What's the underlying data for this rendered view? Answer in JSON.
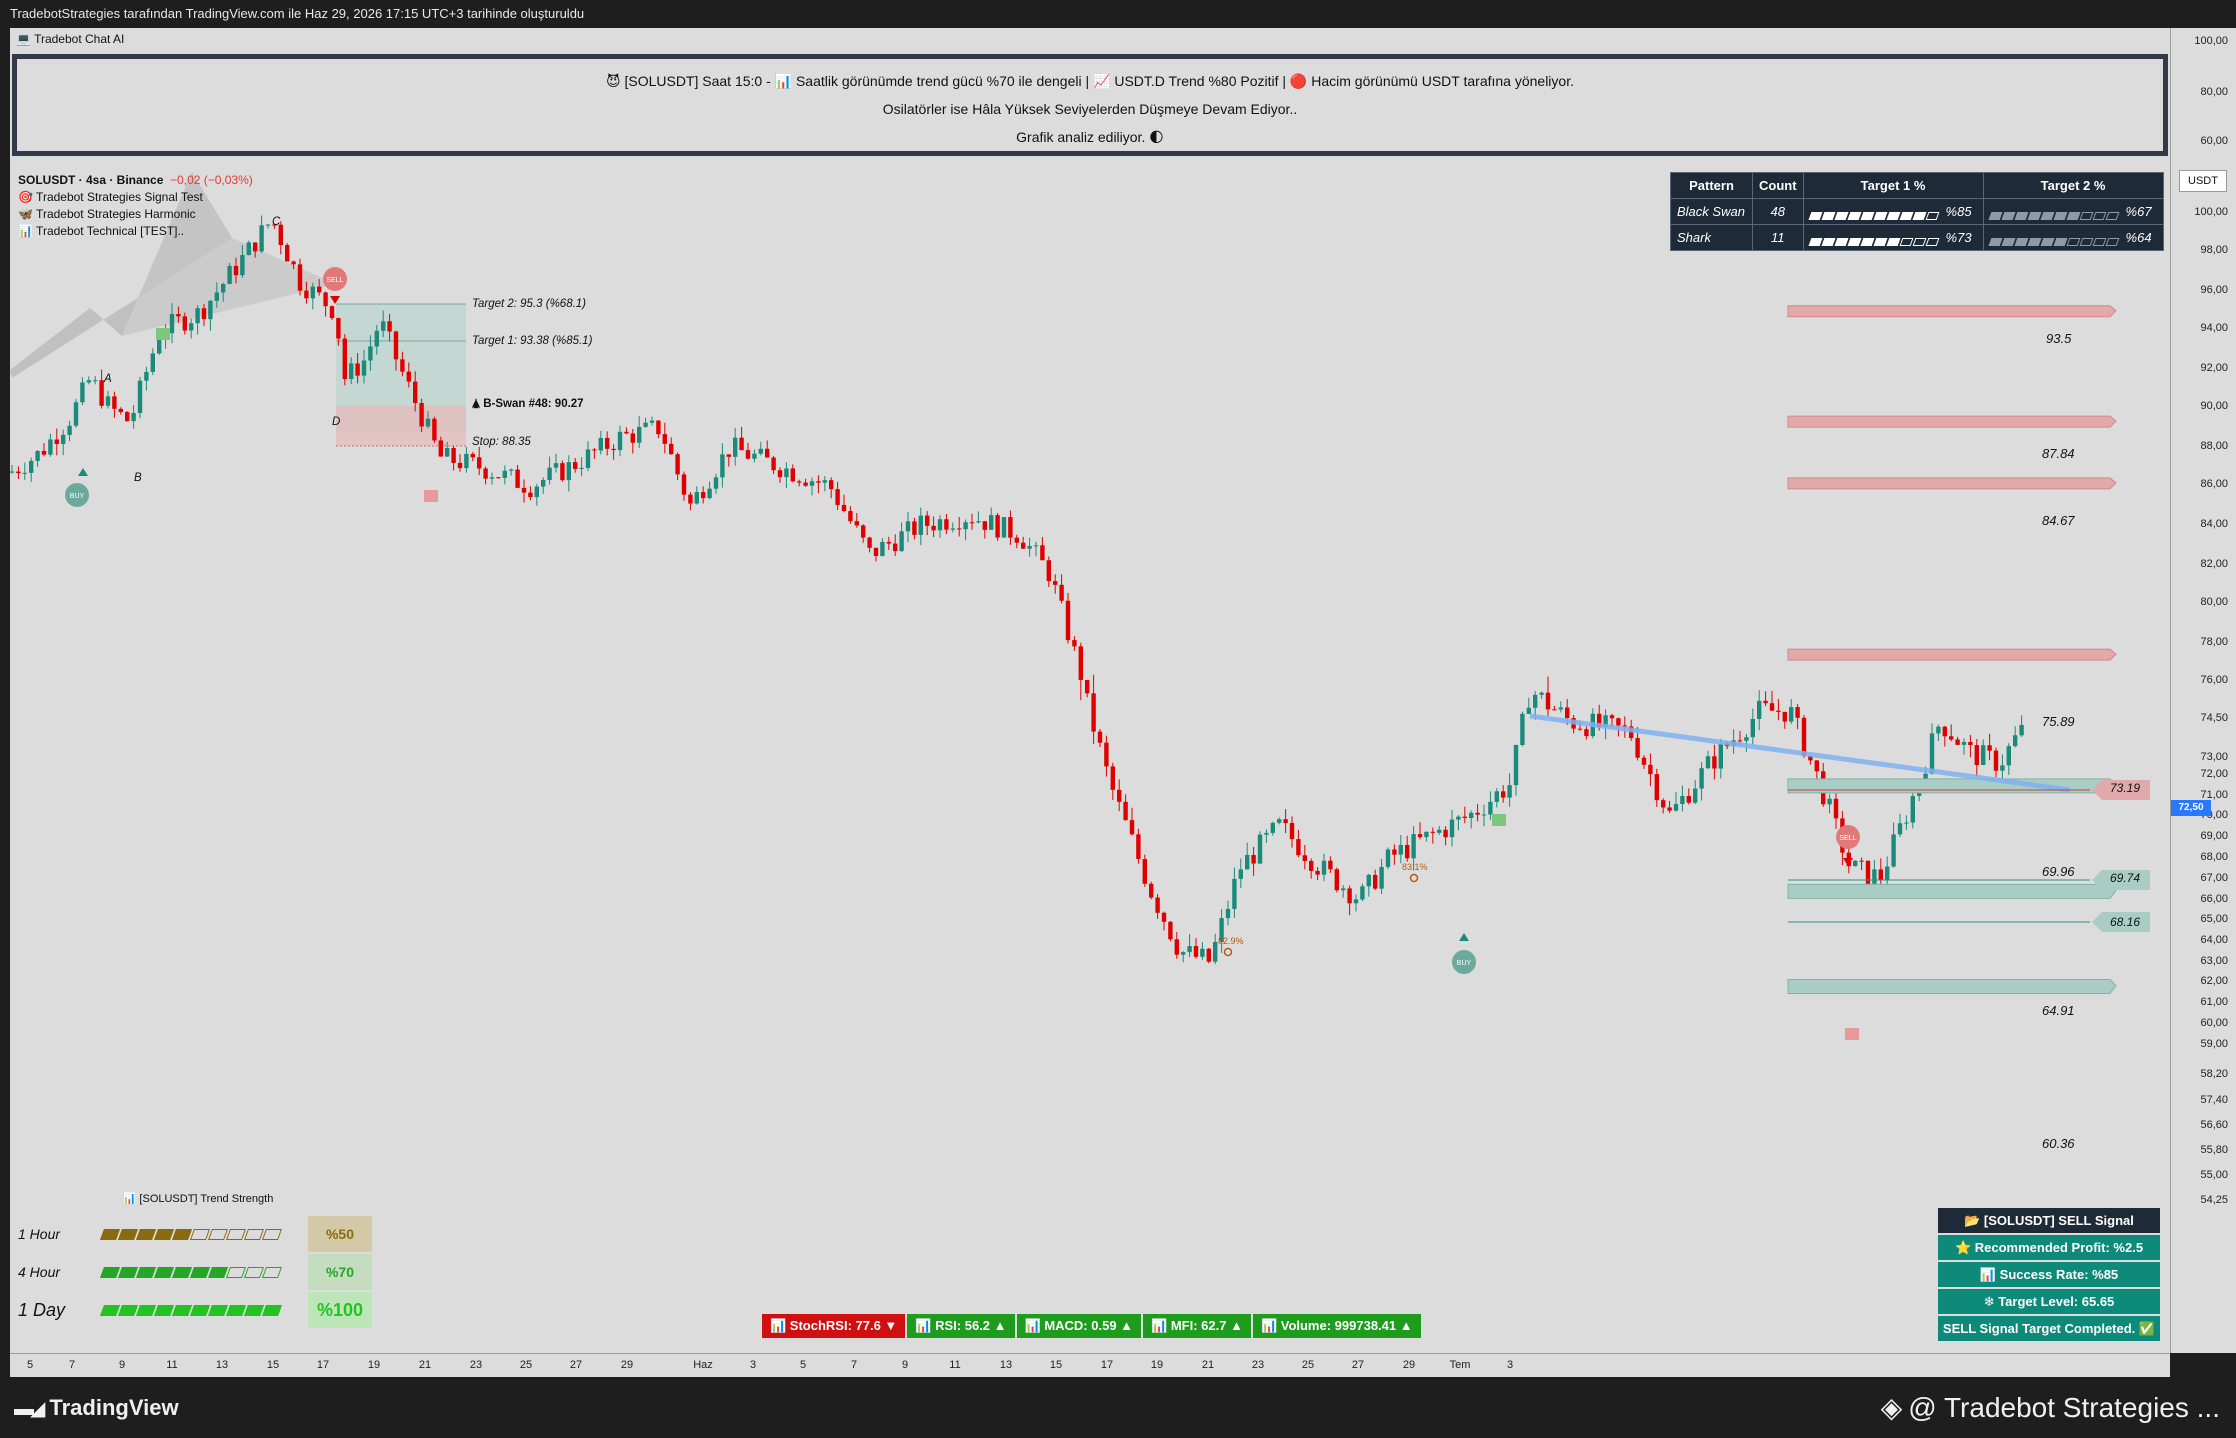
{
  "header": {
    "caption": "TradebotStrategies tarafından TradingView.com ile Haz 29, 2026 17:15 UTC+3 tarihinde oluşturuldu"
  },
  "chat": {
    "title": "Tradebot Chat AI",
    "line1": "😈 [SOLUSDT] Saat 15:0 - 📊 Saatlik görünümde trend gücü %70 ile dengeli | 📈 USDT.D Trend %80 Pozitif | 🔴 Hacim görünümü USDT tarafına yöneliyor.",
    "line2": "Osilatörler ise Hâla Yüksek Seviyelerden Düşmeye Devam Ediyor..",
    "line3": "Grafik analiz ediliyor. 🌓"
  },
  "legend": {
    "symbol": "SOLUSDT · 4sa · Binance",
    "change": "−0,02 (−0,03%)",
    "indicators": [
      "🎯 Tradebot Strategies Signal Test",
      "🦋 Tradebot Strategies Harmonic",
      "📊 Tradebot Technical [TEST].."
    ]
  },
  "pattern_table": {
    "headers": [
      "Pattern",
      "Count",
      "Target 1 %",
      "Target 2 %"
    ],
    "rows": [
      {
        "name": "Black Swan",
        "count": "48",
        "t1": "%85",
        "t1_value": 0.85,
        "t2": "%67",
        "t2_value": 0.67
      },
      {
        "name": "Shark",
        "count": "11",
        "t1": "%73",
        "t1_value": 0.73,
        "t2": "%64",
        "t2_value": 0.64
      }
    ]
  },
  "harmonic": {
    "points": {
      "a": "A",
      "b": "B",
      "c": "C",
      "d": "D"
    },
    "target2": "Target 2: 95.3 (%68.1)",
    "target1": "Target 1: 93.38 (%85.1)",
    "pattern": "🛦 B-Swan #48: 90.27",
    "stop": "Stop: 88.35",
    "sell": "SELL",
    "buy": "BUY"
  },
  "fib_labels": {
    "f1": "82.9%",
    "f2": "83.1%"
  },
  "levels": {
    "resistance": [
      {
        "label": "93.5",
        "value": 93.5
      },
      {
        "label": "87.84",
        "value": 87.84
      },
      {
        "label": "84.67",
        "value": 84.67
      },
      {
        "label": "75.89",
        "value": 75.89
      }
    ],
    "support": [
      {
        "label": "69.96",
        "value": 69.96
      },
      {
        "label": "64.91",
        "value": 64.91
      },
      {
        "label": "60.36",
        "value": 60.36
      }
    ],
    "line_73": "73.19",
    "line_69": "69.74",
    "line_68": "68.16"
  },
  "price_axis": {
    "currency": "USDT",
    "current": "72,50",
    "current_value": 72.5,
    "upper_ticks": [
      "100,00",
      "80,00",
      "60,00"
    ],
    "ticks": [
      "100,00",
      "98,00",
      "96,00",
      "94,00",
      "92,00",
      "90,00",
      "88,00",
      "86,00",
      "84,00",
      "82,00",
      "80,00",
      "78,00",
      "76,00",
      "74,50",
      "73,00",
      "72,00",
      "71,00",
      "70,00",
      "69,00",
      "68,00",
      "67,00",
      "66,00",
      "65,00",
      "64,00",
      "63,00",
      "62,00",
      "61,00",
      "60,00",
      "59,00",
      "58,20",
      "57,40",
      "56,60",
      "55,80",
      "55,00",
      "54,25"
    ]
  },
  "time_axis": {
    "ticks": [
      "5",
      "7",
      "9",
      "11",
      "13",
      "15",
      "17",
      "19",
      "21",
      "23",
      "25",
      "27",
      "29",
      "Haz",
      "3",
      "5",
      "7",
      "9",
      "11",
      "13",
      "15",
      "17",
      "19",
      "21",
      "23",
      "25",
      "27",
      "29",
      "Tem",
      "3"
    ]
  },
  "trend_strength": {
    "title": "📊 [SOLUSDT] Trend Strength",
    "rows": [
      {
        "label": "1 Hour",
        "pct": "%50",
        "value": 0.5,
        "color": "#8a6a10",
        "bg": "#d3c9a6"
      },
      {
        "label": "4 Hour",
        "pct": "%70",
        "value": 0.7,
        "color": "#26a626",
        "bg": "#c4dcc0"
      },
      {
        "label": "1 Day",
        "pct": "%100",
        "value": 1.0,
        "color": "#22c322",
        "bg": "#bde6b8"
      }
    ]
  },
  "indicators": [
    {
      "label": "📊 StochRSI: 77.6 ▼",
      "color": "#d01010"
    },
    {
      "label": "📊 RSI: 56.2 ▲",
      "color": "#1e9c1e"
    },
    {
      "label": "📊 MACD: 0.59 ▲",
      "color": "#1e9c1e"
    },
    {
      "label": "📊 MFI: 62.7 ▲",
      "color": "#1e9c1e"
    },
    {
      "label": "📊 Volume: 999738.41 ▲",
      "color": "#1e9c1e"
    }
  ],
  "signal": {
    "title": "📂 [SOLUSDT] SELL Signal",
    "profit": "⭐ Recommended Profit: %2.5",
    "success": "📊 Success Rate: %85",
    "target": "❄ Target Level: 65.65",
    "completed": "SELL Signal Target Completed. ✅"
  },
  "footer": {
    "brand": "TradingView",
    "author": "@ Tradebot Strategies ..."
  },
  "colors": {
    "up": "#1a8a7a",
    "down": "#e00000",
    "panel": "#1f2a38",
    "teal": "#0e8a7a"
  }
}
